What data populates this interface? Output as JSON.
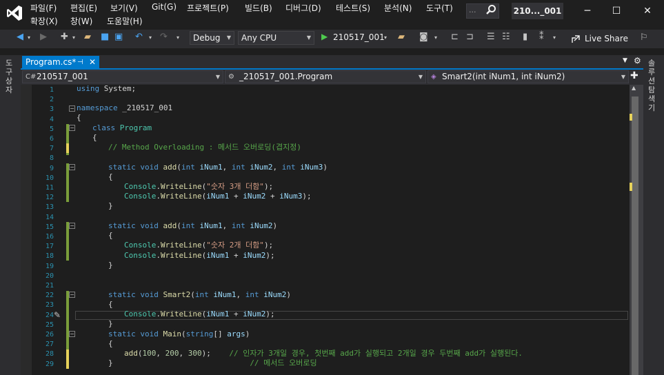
{
  "menu": {
    "file": "파일(F)",
    "edit": "편집(E)",
    "view": "보기(V)",
    "git": "Git(G)",
    "project": "프로젝트(P)",
    "build": "빌드(B)",
    "debug": "디버그(D)",
    "test": "테스트(S)",
    "analyze": "분석(N)",
    "tools": "도구(T)",
    "extensions": "확장(X)",
    "window": "창(W)",
    "help": "도움말(H)"
  },
  "search_placeholder": "...",
  "solution_name": "210..._001",
  "toolbar": {
    "config": "Debug",
    "platform": "Any CPU",
    "run_target": "210517_001",
    "live_share": "Live Share"
  },
  "left_strip_label": "도구 상자",
  "right_strip_label": "솔루션 탐색기",
  "tab": {
    "title": "Program.cs*",
    "pin": "⊣",
    "close": "✕"
  },
  "nav": {
    "project": "210517_001",
    "type": "_210517_001.Program",
    "member": "Smart2(int iNum1, int iNum2)"
  },
  "line_numbers": [
    "1",
    "2",
    "3",
    "4",
    "5",
    "6",
    "7",
    "8",
    "9",
    "10",
    "11",
    "12",
    "13",
    "14",
    "15",
    "16",
    "17",
    "18",
    "19",
    "20",
    "21",
    "22",
    "23",
    "24",
    "25",
    "26",
    "27",
    "28",
    "29"
  ],
  "code": {
    "l1": [
      "using ",
      "System",
      ";"
    ],
    "l3": [
      "namespace ",
      "_210517_001"
    ],
    "l4": "{",
    "l5": [
      "class ",
      "Program"
    ],
    "l6": "{",
    "l7": "// Method Overloading : 메서드 오버로딩(겹지정)",
    "l9": [
      "static ",
      "void ",
      "add",
      "(",
      "int ",
      "iNum1",
      ", ",
      "int ",
      "iNum2",
      ", ",
      "int ",
      "iNum3",
      ")"
    ],
    "l10": "{",
    "l11": [
      "Console",
      ".",
      "WriteLine",
      "(",
      "\"숫자 3개 더함\"",
      ");"
    ],
    "l12": [
      "Console",
      ".",
      "WriteLine",
      "(",
      "iNum1",
      " + ",
      "iNum2",
      " + ",
      "iNum3",
      ");"
    ],
    "l13": "}",
    "l15": [
      "static ",
      "void ",
      "add",
      "(",
      "int ",
      "iNum1",
      ", ",
      "int ",
      "iNum2",
      ")"
    ],
    "l16": "{",
    "l17": [
      "Console",
      ".",
      "WriteLine",
      "(",
      "\"숫자 2개 더함\"",
      ");"
    ],
    "l18": [
      "Console",
      ".",
      "WriteLine",
      "(",
      "iNum1",
      " + ",
      "iNum2",
      ");"
    ],
    "l19": "}",
    "l22": [
      "static ",
      "void ",
      "Smart2",
      "(",
      "int ",
      "iNum1",
      ", ",
      "int ",
      "iNum2",
      ")"
    ],
    "l23": "{",
    "l24": [
      "Console",
      ".",
      "WriteLine",
      "(",
      "iNum1",
      " + ",
      "iNum2",
      ");"
    ],
    "l25": "}",
    "l26": [
      "static ",
      "void ",
      "Main",
      "(",
      "string",
      "[] ",
      "args",
      ")"
    ],
    "l27": "{",
    "l28": [
      "add",
      "(",
      "100",
      ", ",
      "200",
      ", ",
      "300",
      ");    ",
      "// 인자가 3개일 경우, 첫번째 add가 실행되고 2개일 경우 두번째 add가 실행된다."
    ],
    "l29": [
      "}",
      "                              ",
      "// 메서드 오버로딩"
    ]
  },
  "colors": {
    "accent": "#007acc",
    "keyword": "#569cd6",
    "type": "#4ec9b0",
    "comment": "#57a64a",
    "string": "#d69d85"
  }
}
